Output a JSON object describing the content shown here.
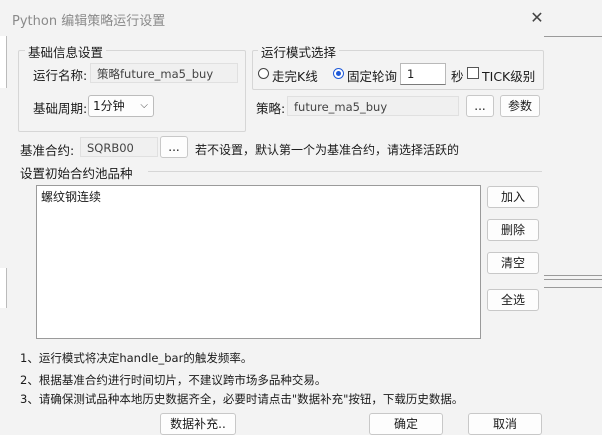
{
  "title": "Python 编辑策略运行设置",
  "basic_group": {
    "legend": "基础信息设置",
    "run_name_label": "运行名称:",
    "run_name_value": "策略future_ma5_buy",
    "period_label": "基础周期:",
    "period_value": "1分钟"
  },
  "mode_group": {
    "legend": "运行模式选择",
    "option_kline": "走完K线",
    "option_fixed": "固定轮询",
    "interval_value": "1",
    "seconds_label": "秒",
    "tick_label": "TICK级别",
    "selected": "固定轮询",
    "tick_checked": false,
    "strategy_label": "策略:",
    "strategy_value": "future_ma5_buy",
    "browse_label": "...",
    "params_label": "参数"
  },
  "benchmark": {
    "label": "基准合约:",
    "value": "SQRB00",
    "browse_label": "...",
    "hint": "若不设置，默认第一个为基准合约，请选择活跃的"
  },
  "initial_contracts": {
    "legend": "设置初始合约池品种",
    "items": [
      "螺纹钢连续"
    ],
    "add_label": "加入",
    "delete_label": "删除",
    "clear_label": "清空",
    "select_all_label": "全选"
  },
  "notes": [
    "1、运行模式将决定handle_bar的触发频率。",
    "2、根据基准合约进行时间切片，不建议跨市场多品种交易。",
    "3、请确保测试品种本地历史数据齐全，必要时请点击\"数据补充\"按钮，下载历史数据。"
  ],
  "footer": {
    "data_fill_label": "数据补充..",
    "ok_label": "确定",
    "cancel_label": "取消"
  },
  "colors": {
    "accent": "#1f5ad8",
    "dialog_bg": "#f3f3f3"
  }
}
